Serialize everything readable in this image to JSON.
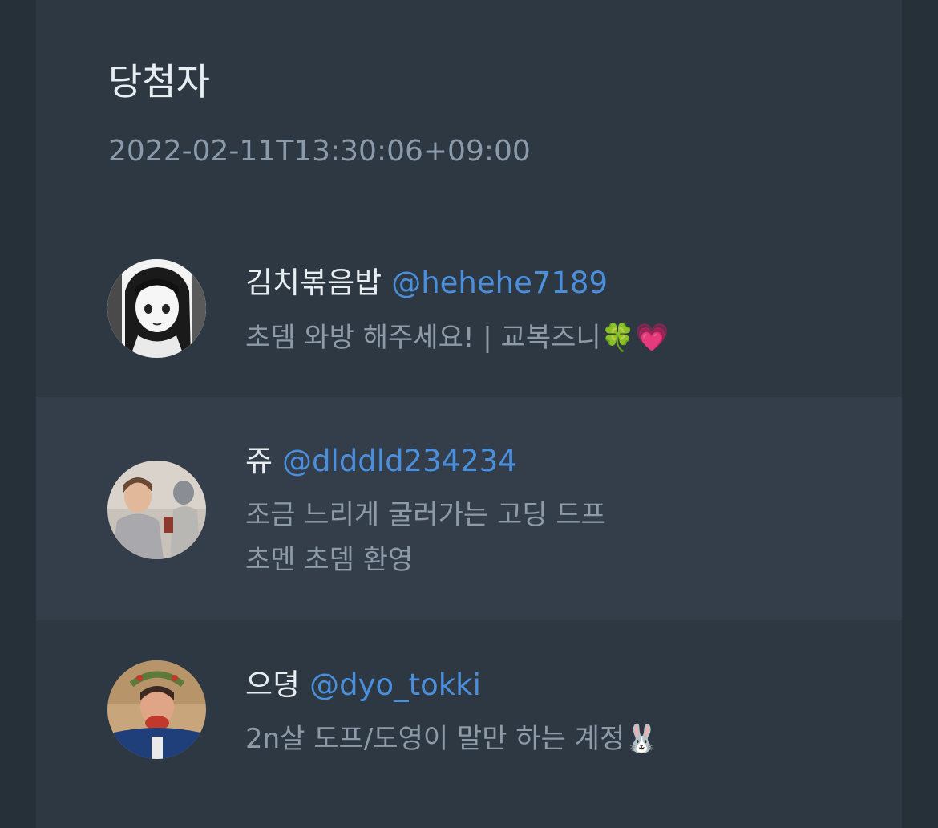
{
  "header": {
    "title": "당첨자",
    "timestamp": "2022-02-11T13:30:06+09:00"
  },
  "winners": [
    {
      "name": "김치볶음밥",
      "handle": "@hehehe7189",
      "bio_lines": [
        "초뎀 와방 해주세요! | 교복즈니🍀💗"
      ],
      "avatar_icon": "user-avatar-anime-girl"
    },
    {
      "name": "쥬",
      "handle": "@dlddld234234",
      "bio_lines": [
        "조금 느리게 굴러가는 고딩 드프",
        "초멘 초뎀 환영"
      ],
      "avatar_icon": "user-avatar-photo"
    },
    {
      "name": "으뎡",
      "handle": "@dyo_tokki",
      "bio_lines": [
        "2n살 도프/도영이 말만 하는 계정🐰"
      ],
      "avatar_icon": "user-avatar-photo"
    }
  ],
  "colors": {
    "background": "#253039",
    "panel": "#2d3843",
    "panel_alt": "#333e4a",
    "handle": "#4b8fdc",
    "text_primary": "#e8edf1",
    "text_secondary": "#8d9aa7"
  }
}
